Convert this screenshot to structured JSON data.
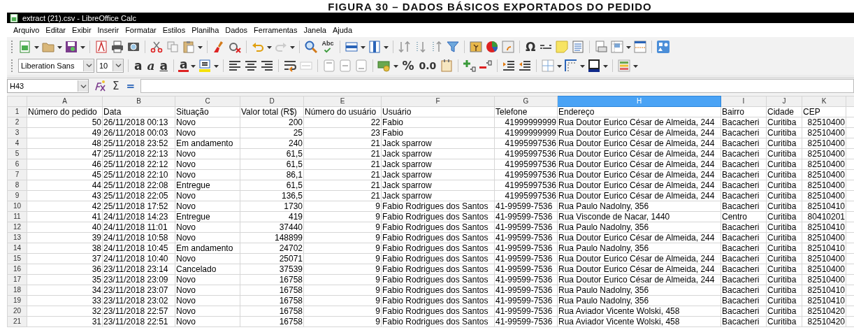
{
  "caption": "FIGURA 30 – DADOS BÁSICOS EXPORTADOS DO PEDIDO",
  "window": {
    "title": "extract (21).csv - LibreOffice Calc"
  },
  "menu": [
    "Arquivo",
    "Editar",
    "Exibir",
    "Inserir",
    "Formatar",
    "Estilos",
    "Planilha",
    "Dados",
    "Ferramentas",
    "Janela",
    "Ajuda"
  ],
  "standard_toolbar": {
    "spellcheck_label": "Abc",
    "special_character": "Ω"
  },
  "formatting_toolbar": {
    "font_name": "Liberation Sans",
    "font_size": "10",
    "bold": "a",
    "italic": "a",
    "underline": "a",
    "font_color": "a",
    "percent": "%",
    "decimal": "0.0"
  },
  "formula_bar": {
    "name_box": "H43",
    "sum": "Σ",
    "equals": "="
  },
  "columns": [
    {
      "label": "A",
      "selected": false
    },
    {
      "label": "B",
      "selected": false
    },
    {
      "label": "C",
      "selected": false
    },
    {
      "label": "D",
      "selected": false
    },
    {
      "label": "E",
      "selected": false
    },
    {
      "label": "F",
      "selected": false
    },
    {
      "label": "G",
      "selected": false
    },
    {
      "label": "H",
      "selected": true
    },
    {
      "label": "I",
      "selected": false
    },
    {
      "label": "J",
      "selected": false
    },
    {
      "label": "K",
      "selected": false
    }
  ],
  "rows": [
    {
      "number": "1",
      "cells": [
        "Número do pedido",
        "Data",
        "Situação",
        "Valor total (R$)",
        "Número do usuário",
        "Usuário",
        "Telefone",
        "Endereço",
        "Bairro",
        "Cidade",
        "CEP"
      ]
    },
    {
      "number": "2",
      "cells": [
        "50",
        "26/11/2018 00:13",
        "Novo",
        "200",
        "22",
        "Fabio",
        "41999999999",
        "Rua Doutor Eurico César de Almeida, 244",
        "Bacacheri",
        "Curitiba",
        "82510400"
      ]
    },
    {
      "number": "3",
      "cells": [
        "49",
        "26/11/2018 00:03",
        "Novo",
        "25",
        "23",
        "Fabio",
        "41999999999",
        "Rua Doutor Eurico César de Almeida, 244",
        "Bacacheri",
        "Curitiba",
        "82510400"
      ]
    },
    {
      "number": "4",
      "cells": [
        "48",
        "25/11/2018 23:52",
        "Em andamento",
        "240",
        "21",
        "Jack sparrow",
        "41995997536",
        "Rua Doutor Eurico César de Almeida, 244",
        "Bacacheri",
        "Curitiba",
        "82510400"
      ]
    },
    {
      "number": "5",
      "cells": [
        "47",
        "25/11/2018 22:13",
        "Novo",
        "61,5",
        "21",
        "Jack sparrow",
        "41995997536",
        "Rua Doutor Eurico César de Almeida, 244",
        "Bacacheri",
        "Curitiba",
        "82510400"
      ]
    },
    {
      "number": "6",
      "cells": [
        "46",
        "25/11/2018 22:12",
        "Novo",
        "61,5",
        "21",
        "Jack sparrow",
        "41995997536",
        "Rua Doutor Eurico César de Almeida, 244",
        "Bacacheri",
        "Curitiba",
        "82510400"
      ]
    },
    {
      "number": "7",
      "cells": [
        "45",
        "25/11/2018 22:10",
        "Novo",
        "86,1",
        "21",
        "Jack sparrow",
        "41995997536",
        "Rua Doutor Eurico César de Almeida, 244",
        "Bacacheri",
        "Curitiba",
        "82510400"
      ]
    },
    {
      "number": "8",
      "cells": [
        "44",
        "25/11/2018 22:08",
        "Entregue",
        "61,5",
        "21",
        "Jack sparrow",
        "41995997536",
        "Rua Doutor Eurico César de Almeida, 244",
        "Bacacheri",
        "Curitiba",
        "82510400"
      ]
    },
    {
      "number": "9",
      "cells": [
        "43",
        "25/11/2018 22:05",
        "Novo",
        "136,5",
        "21",
        "Jack sparrow",
        "41995997536",
        "Rua Doutor Eurico César de Almeida, 244",
        "Bacacheri",
        "Curitiba",
        "82510400"
      ]
    },
    {
      "number": "10",
      "cells": [
        "42",
        "25/11/2018 17:52",
        "Novo",
        "1730",
        "9",
        "Fabio Rodrigues dos Santos",
        "41-99599-7536",
        "Rua Paulo Nadolny, 356",
        "Bacacheri",
        "Curitiba",
        "82510410"
      ]
    },
    {
      "number": "11",
      "cells": [
        "41",
        "24/11/2018 14:23",
        "Entregue",
        "419",
        "9",
        "Fabio Rodrigues dos Santos",
        "41-99599-7536",
        "Rua Visconde de Nacar, 1440",
        "Centro",
        "Curitiba",
        "80410201"
      ]
    },
    {
      "number": "12",
      "cells": [
        "40",
        "24/11/2018 11:01",
        "Novo",
        "37440",
        "9",
        "Fabio Rodrigues dos Santos",
        "41-99599-7536",
        "Rua Paulo Nadolny, 356",
        "Bacacheri",
        "Curitiba",
        "82510410"
      ]
    },
    {
      "number": "13",
      "cells": [
        "39",
        "24/11/2018 10:58",
        "Novo",
        "148899",
        "9",
        "Fabio Rodrigues dos Santos",
        "41-99599-7536",
        "Rua Doutor Eurico César de Almeida, 244",
        "Bacacheri",
        "Curitiba",
        "82510400"
      ]
    },
    {
      "number": "14",
      "cells": [
        "38",
        "24/11/2018 10:45",
        "Em andamento",
        "24702",
        "9",
        "Fabio Rodrigues dos Santos",
        "41-99599-7536",
        "Rua Paulo Nadolny, 356",
        "Bacacheri",
        "Curitiba",
        "82510410"
      ]
    },
    {
      "number": "15",
      "cells": [
        "37",
        "24/11/2018 10:40",
        "Novo",
        "25071",
        "9",
        "Fabio Rodrigues dos Santos",
        "41-99599-7536",
        "Rua Doutor Eurico César de Almeida, 244",
        "Bacacheri",
        "Curitiba",
        "82510400"
      ]
    },
    {
      "number": "16",
      "cells": [
        "36",
        "23/11/2018 23:14",
        "Cancelado",
        "37539",
        "9",
        "Fabio Rodrigues dos Santos",
        "41-99599-7536",
        "Rua Doutor Eurico César de Almeida, 244",
        "Bacacheri",
        "Curitiba",
        "82510400"
      ]
    },
    {
      "number": "17",
      "cells": [
        "35",
        "23/11/2018 23:09",
        "Novo",
        "16758",
        "9",
        "Fabio Rodrigues dos Santos",
        "41-99599-7536",
        "Rua Doutor Eurico César de Almeida, 244",
        "Bacacheri",
        "Curitiba",
        "82510400"
      ]
    },
    {
      "number": "18",
      "cells": [
        "34",
        "23/11/2018 23:07",
        "Novo",
        "16758",
        "9",
        "Fabio Rodrigues dos Santos",
        "41-99599-7536",
        "Rua Paulo Nadolny, 356",
        "Bacacheri",
        "Curitiba",
        "82510410"
      ]
    },
    {
      "number": "19",
      "cells": [
        "33",
        "23/11/2018 23:02",
        "Novo",
        "16758",
        "9",
        "Fabio Rodrigues dos Santos",
        "41-99599-7536",
        "Rua Paulo Nadolny, 356",
        "Bacacheri",
        "Curitiba",
        "82510410"
      ]
    },
    {
      "number": "20",
      "cells": [
        "32",
        "23/11/2018 22:57",
        "Novo",
        "16758",
        "9",
        "Fabio Rodrigues dos Santos",
        "41-99599-7536",
        "Rua Aviador Vicente Wolski, 458",
        "Bacacheri",
        "Curitiba",
        "82510420"
      ]
    },
    {
      "number": "21",
      "cells": [
        "31",
        "23/11/2018 22:51",
        "Novo",
        "16758",
        "9",
        "Fabio Rodrigues dos Santos",
        "41-99599-7536",
        "Rua Aviador Vicente Wolski, 458",
        "Bacacheri",
        "Curitiba",
        "82510420"
      ]
    }
  ]
}
